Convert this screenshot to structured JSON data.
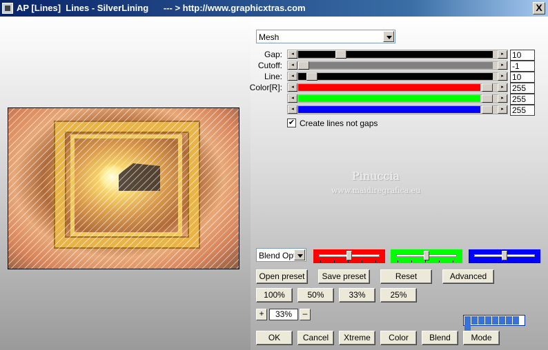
{
  "window": {
    "title": "AP [Lines]  Lines - SilverLining      --- > http://www.graphicxtras.com",
    "close_label": "X"
  },
  "mode_dropdown": {
    "value": "Mesh"
  },
  "params": [
    {
      "label": "Gap:",
      "value": "10",
      "fill_color": "#000000",
      "position": 0.2
    },
    {
      "label": "Cutoff:",
      "value": "-1",
      "fill_color": "#808080",
      "position": 0.0
    },
    {
      "label": "Line:",
      "value": "10",
      "fill_color": "#000000",
      "position": 0.05
    },
    {
      "label": "Color[R]:",
      "value": "255",
      "fill_color": "#ff0000",
      "position": 1.0
    },
    {
      "label": "",
      "value": "255",
      "fill_color": "#00ff00",
      "position": 1.0
    },
    {
      "label": "",
      "value": "255",
      "fill_color": "#0000ff",
      "position": 1.0
    }
  ],
  "checkbox": {
    "label": "Create lines not gaps",
    "checked": true,
    "mark": "✔"
  },
  "watermark": {
    "line1": "Pinuccia",
    "line2": "www.maidiregrafica.eu"
  },
  "blend_dropdown": {
    "value": "Blend Optio"
  },
  "color_sliders": [
    {
      "color": "#ff0000",
      "position": 0.5
    },
    {
      "color": "#00ff00",
      "position": 0.5
    },
    {
      "color": "#0000ff",
      "position": 0.5
    }
  ],
  "preset_buttons": {
    "open": "Open preset",
    "save": "Save preset",
    "reset": "Reset",
    "advanced": "Advanced"
  },
  "zoom_buttons": [
    "100%",
    "50%",
    "33%",
    "25%"
  ],
  "zoom": {
    "plus": "+",
    "value": "33%",
    "minus": "–"
  },
  "progress": {
    "segments": 9
  },
  "bottom_buttons": {
    "ok": "OK",
    "cancel": "Cancel",
    "xtreme": "Xtreme",
    "color": "Color",
    "blend": "Blend",
    "mode": "Mode"
  }
}
